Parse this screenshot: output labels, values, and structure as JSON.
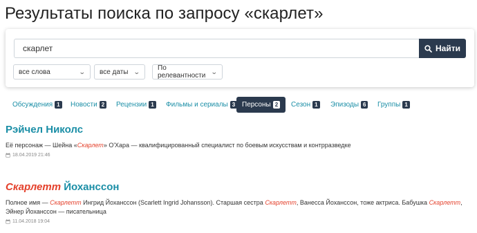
{
  "page": {
    "title": "Результаты поиска по запросу «скарлет»"
  },
  "search": {
    "value": "скарлет",
    "button_label": "Найти",
    "filters": {
      "words": "все слова",
      "dates": "все даты",
      "sort": "По релевантности"
    }
  },
  "tabs": [
    {
      "label": "Обсуждения",
      "count": "1",
      "active": false
    },
    {
      "label": "Новости",
      "count": "2",
      "active": false
    },
    {
      "label": "Рецензии",
      "count": "1",
      "active": false
    },
    {
      "label": "Фильмы и сериалы",
      "count": "3",
      "active": false
    },
    {
      "label": "Персоны",
      "count": "2",
      "active": true
    },
    {
      "label": "Сезон",
      "count": "1",
      "active": false
    },
    {
      "label": "Эпизоды",
      "count": "6",
      "active": false
    },
    {
      "label": "Группы",
      "count": "1",
      "active": false
    }
  ],
  "results": [
    {
      "title_parts": [
        {
          "text": "Рэйчел Николс",
          "hl": false
        }
      ],
      "desc_parts": [
        {
          "text": "Её персонаж — Шейна «",
          "hl": false
        },
        {
          "text": "Скарлет",
          "hl": true
        },
        {
          "text": "» О'Хара — квалифицированный специалист по боевым искусствам и контрразведке",
          "hl": false
        }
      ],
      "date": "18.04.2019 21:46"
    },
    {
      "title_parts": [
        {
          "text": "Скарлетт",
          "hl": true
        },
        {
          "text": " Йоханссон",
          "hl": false
        }
      ],
      "desc_parts": [
        {
          "text": "Полное имя — ",
          "hl": false
        },
        {
          "text": "Скарлетт",
          "hl": true
        },
        {
          "text": " Ингрид Йоханссон (Scarlett Ingrid Johansson). Старшая сестра ",
          "hl": false
        },
        {
          "text": "Скарлетт",
          "hl": true
        },
        {
          "text": ", Ванесса Йоханссон, тоже актриса. Бабушка ",
          "hl": false
        },
        {
          "text": "Скарлетт",
          "hl": true
        },
        {
          "text": ", Эйнер Йоханссон — писательница",
          "hl": false
        }
      ],
      "date": "11.04.2018 19:04"
    }
  ],
  "icons": {
    "search": "search-icon",
    "calendar": "calendar-icon",
    "chevron": "chevron-down-icon"
  },
  "colors": {
    "accent": "#1a8ea6",
    "dark": "#2b3a4e",
    "highlight": "#e4402b"
  }
}
